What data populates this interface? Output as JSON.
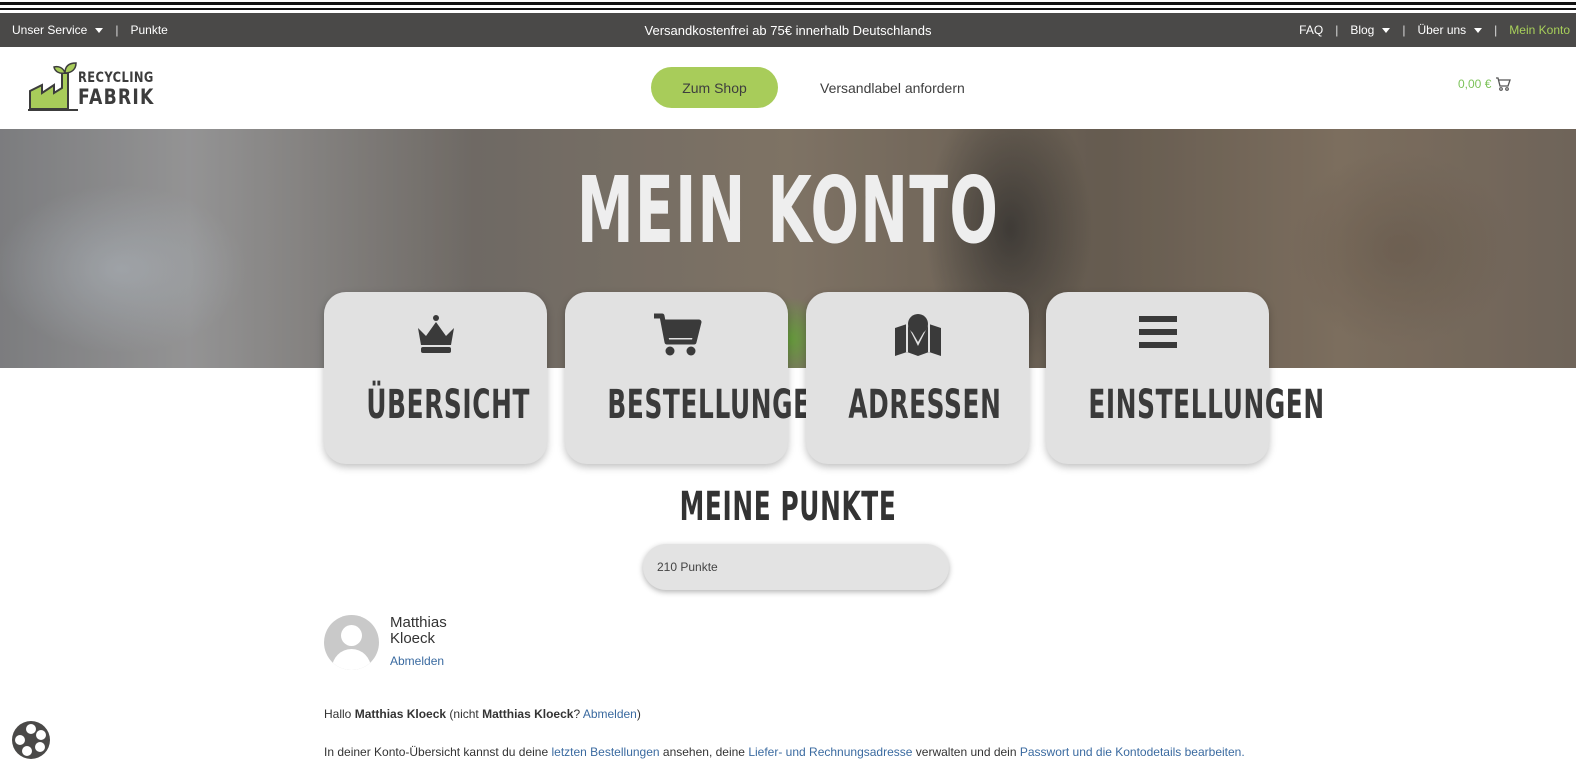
{
  "topbar": {
    "service": "Unser Service",
    "points": "Punkte",
    "announcement": "Versandkostenfrei ab 75€ innerhalb Deutschlands",
    "faq": "FAQ",
    "blog": "Blog",
    "about": "Über uns",
    "account": "Mein Konto",
    "separator": "|"
  },
  "header": {
    "logo_line1": "RECYCLING",
    "logo_line2": "FABRIK",
    "shop_button": "Zum Shop",
    "label_link": "Versandlabel anfordern",
    "cart_total": "0,00 €"
  },
  "hero": {
    "title": "Mein Konto"
  },
  "cards": [
    {
      "label": "Übersicht",
      "icon": "crown-icon"
    },
    {
      "label": "Bestellungen",
      "icon": "cart-icon"
    },
    {
      "label": "Adressen",
      "icon": "map-icon"
    },
    {
      "label": "Einstellungen",
      "icon": "menu-icon"
    }
  ],
  "points": {
    "title": "Meine Punkte",
    "value": "210 Punkte"
  },
  "user": {
    "first_name": "Matthias",
    "last_name": "Kloeck",
    "logout": "Abmelden"
  },
  "greeting": {
    "hello": "Hallo",
    "name": "Matthias Kloeck",
    "not_prefix": "(nicht",
    "name2": "Matthias Kloeck",
    "question": "?",
    "logout": "Abmelden",
    "close": ")"
  },
  "overview": {
    "t1": "In deiner Konto-Übersicht kannst du deine",
    "l1": "letzten Bestellungen",
    "t2": "ansehen, deine",
    "l2": "Liefer- und Rechnungsadresse",
    "t3": "verwalten und dein",
    "l3": "Passwort und die Kontodetails bearbeiten",
    "t4": "."
  },
  "colors": {
    "topbar_bg": "#4a4948",
    "accent_green": "#a8cc5a",
    "link_blue": "#3a6aa0",
    "card_bg": "#e1e1e1"
  }
}
